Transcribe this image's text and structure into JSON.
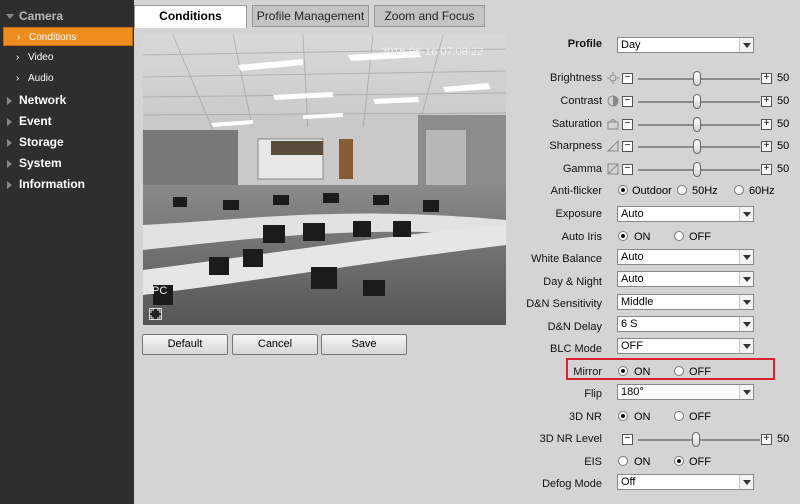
{
  "sidebar": {
    "camera": "Camera",
    "conditions": "Conditions",
    "video": "Video",
    "audio": "Audio",
    "network": "Network",
    "event": "Event",
    "storage": "Storage",
    "system": "System",
    "information": "Information"
  },
  "tabs": {
    "conditions": "Conditions",
    "profile_management": "Profile Management",
    "zoom_focus": "Zoom and Focus"
  },
  "preview": {
    "timestamp": "2016-06-16 07:08:22",
    "channel": "IPC"
  },
  "buttons": {
    "default": "Default",
    "cancel": "Cancel",
    "save": "Save"
  },
  "settings": {
    "profile": {
      "label": "Profile",
      "value": "Day"
    },
    "brightness": {
      "label": "Brightness",
      "value": 50
    },
    "contrast": {
      "label": "Contrast",
      "value": 50
    },
    "saturation": {
      "label": "Saturation",
      "value": 50
    },
    "sharpness": {
      "label": "Sharpness",
      "value": 50
    },
    "gamma": {
      "label": "Gamma",
      "value": 50
    },
    "anti_flicker": {
      "label": "Anti-flicker",
      "options": [
        "Outdoor",
        "50Hz",
        "60Hz"
      ],
      "selected": "Outdoor"
    },
    "exposure": {
      "label": "Exposure",
      "value": "Auto"
    },
    "auto_iris": {
      "label": "Auto Iris",
      "options": [
        "ON",
        "OFF"
      ],
      "selected": "ON"
    },
    "white_balance": {
      "label": "White Balance",
      "value": "Auto"
    },
    "day_night": {
      "label": "Day & Night",
      "value": "Auto"
    },
    "dn_sensitivity": {
      "label": "D&N Sensitivity",
      "value": "Middle"
    },
    "dn_delay": {
      "label": "D&N Delay",
      "value": "6 S"
    },
    "blc_mode": {
      "label": "BLC Mode",
      "value": "OFF"
    },
    "mirror": {
      "label": "Mirror",
      "options": [
        "ON",
        "OFF"
      ],
      "selected": "ON"
    },
    "flip": {
      "label": "Flip",
      "value": "180°"
    },
    "nr_3d": {
      "label": "3D NR",
      "options": [
        "ON",
        "OFF"
      ],
      "selected": "ON"
    },
    "nr_3d_level": {
      "label": "3D NR Level",
      "value": 50
    },
    "eis": {
      "label": "EIS",
      "options": [
        "ON",
        "OFF"
      ],
      "selected": "OFF"
    },
    "defog_mode": {
      "label": "Defog Mode",
      "value": "Off"
    }
  },
  "colors": {
    "sidebar_bg": "#2e2e2e",
    "active_item": "#f08c1e",
    "highlight_box": "#d9222a"
  }
}
